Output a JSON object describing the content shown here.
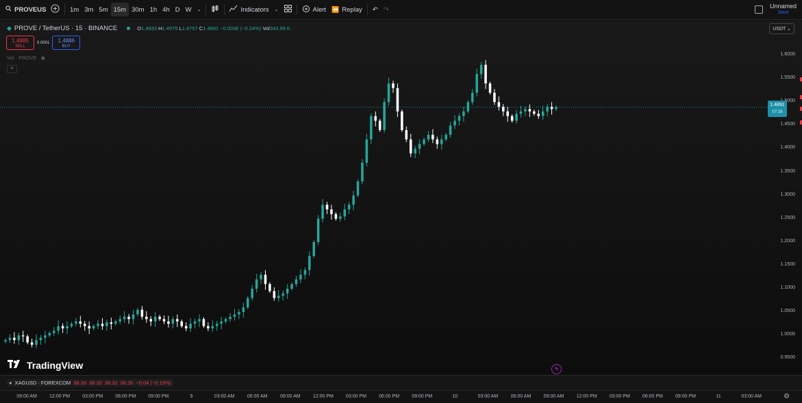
{
  "toolbar": {
    "symbol": "PROVEUS",
    "intervals": [
      "1m",
      "3m",
      "5m",
      "15m",
      "30m",
      "1h",
      "4h",
      "D",
      "W"
    ],
    "active_interval": "15m",
    "indicators_label": "Indicators",
    "alert_label": "Alert",
    "replay_label": "Replay",
    "layout_name": "Unnamed",
    "save_label": "Save"
  },
  "legend": {
    "title": "PROVE / TetherUS · 15 · BINANCE",
    "o_label": "O",
    "o": "1.4933",
    "h_label": "H",
    "h": "1.4975",
    "l_label": "L",
    "l": "1.4757",
    "c_label": "C",
    "c": "1.4891",
    "change": "−0.0036 (−0.24%)",
    "vol_label": "Vol",
    "vol": "343.99 K"
  },
  "trade": {
    "sell_price": "1.4885",
    "sell_label": "SELL",
    "spread": "0.0001",
    "buy_price": "1.4886",
    "buy_label": "BUY"
  },
  "volume_label": "Vol · PROVE",
  "currency": "USDT",
  "price_labels": [
    "1.6000",
    "1.5500",
    "1.5000",
    "1.4500",
    "1.4000",
    "1.3500",
    "1.3000",
    "1.2500",
    "1.2000",
    "1.1500",
    "1.1000",
    "1.0500",
    "1.0000",
    "0.9500"
  ],
  "current_price": {
    "price": "1.4891",
    "countdown": "07:28"
  },
  "brand": "TradingView",
  "subpane": {
    "symbol": "XAGUSD · FOREXCOM",
    "o": "38.39",
    "h": "38.39",
    "l": "38.32",
    "c": "38.35",
    "change": "−0.04 (−0.10%)"
  },
  "time_labels": [
    "09:00 AM",
    "12:00 PM",
    "03:00 PM",
    "06:00 PM",
    "09:00 PM",
    "9",
    "03:00 AM",
    "06:00 AM",
    "09:00 AM",
    "12:00 PM",
    "03:00 PM",
    "06:00 PM",
    "09:00 PM",
    "10",
    "03:00 AM",
    "06:00 AM",
    "09:00 AM",
    "12:00 PM",
    "03:00 PM",
    "06:00 PM",
    "09:00 PM",
    "11",
    "03:00 AM"
  ],
  "colors": {
    "up": "#26a69a",
    "down": "#ffffff",
    "current": "#1f8fa8"
  },
  "chart_data": {
    "type": "candlestick",
    "x_unit": "15-minute bars",
    "ylim": [
      0.93,
      1.62
    ],
    "close": [
      0.99,
      0.995,
      0.99,
      1.0,
      0.998,
      0.985,
      0.98,
      0.99,
      0.995,
      1.0,
      1.005,
      1.01,
      1.02,
      1.015,
      1.02,
      1.025,
      1.03,
      1.025,
      1.02,
      1.015,
      1.02,
      1.025,
      1.02,
      1.028,
      1.025,
      1.03,
      1.035,
      1.04,
      1.035,
      1.045,
      1.055,
      1.04,
      1.035,
      1.03,
      1.04,
      1.035,
      1.03,
      1.025,
      1.035,
      1.03,
      1.02,
      1.015,
      1.025,
      1.03,
      1.035,
      1.02,
      1.015,
      1.02,
      1.025,
      1.03,
      1.035,
      1.04,
      1.045,
      1.05,
      1.06,
      1.08,
      1.1,
      1.12,
      1.13,
      1.11,
      1.095,
      1.08,
      1.085,
      1.09,
      1.1,
      1.11,
      1.12,
      1.13,
      1.14,
      1.17,
      1.2,
      1.25,
      1.28,
      1.27,
      1.26,
      1.25,
      1.255,
      1.27,
      1.28,
      1.3,
      1.33,
      1.37,
      1.42,
      1.47,
      1.46,
      1.44,
      1.5,
      1.54,
      1.53,
      1.48,
      1.44,
      1.42,
      1.39,
      1.4,
      1.41,
      1.42,
      1.43,
      1.42,
      1.41,
      1.42,
      1.43,
      1.45,
      1.46,
      1.47,
      1.48,
      1.5,
      1.52,
      1.56,
      1.58,
      1.54,
      1.52,
      1.5,
      1.49,
      1.48,
      1.47,
      1.46,
      1.475,
      1.48,
      1.485,
      1.48,
      1.475,
      1.47,
      1.48,
      1.49,
      1.485,
      1.489
    ]
  }
}
